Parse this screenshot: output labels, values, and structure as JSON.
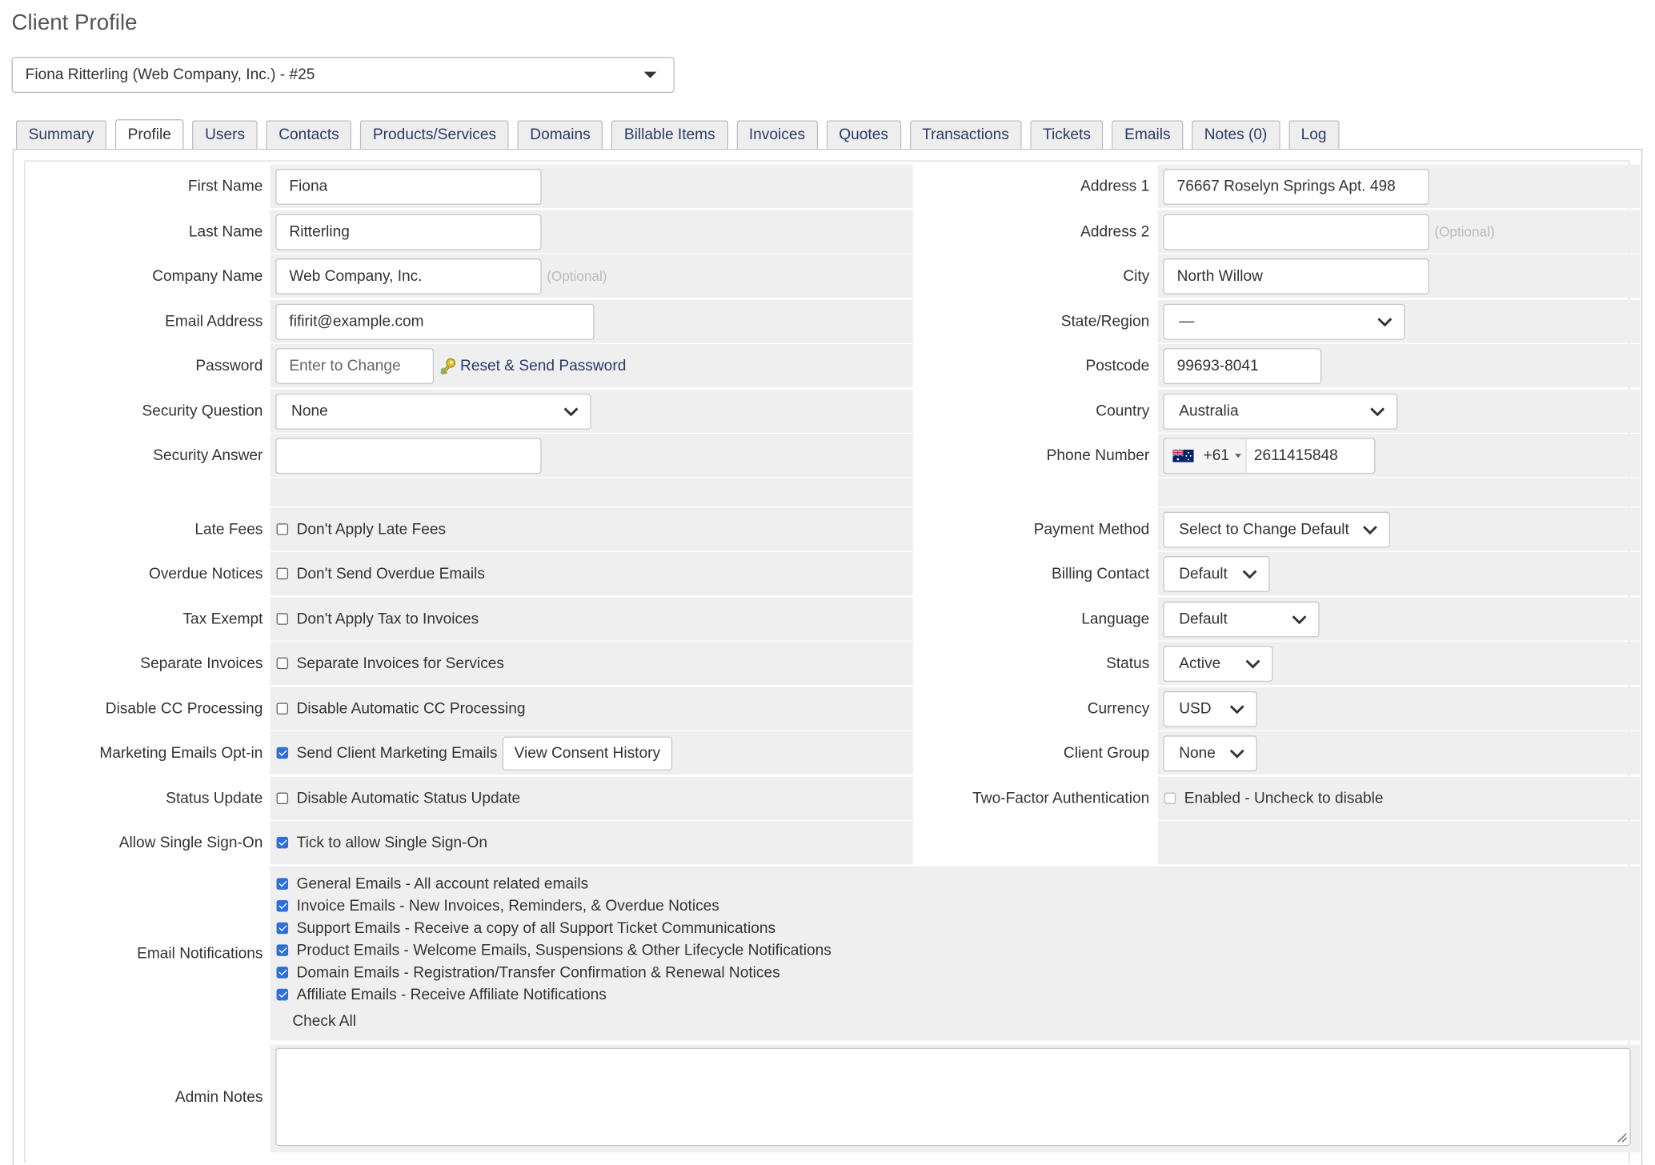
{
  "page": {
    "title": "Client Profile"
  },
  "client_selector": {
    "value": "Fiona Ritterling (Web Company, Inc.) - #25"
  },
  "tabs": [
    {
      "label": "Summary"
    },
    {
      "label": "Profile"
    },
    {
      "label": "Users"
    },
    {
      "label": "Contacts"
    },
    {
      "label": "Products/Services"
    },
    {
      "label": "Domains"
    },
    {
      "label": "Billable Items"
    },
    {
      "label": "Invoices"
    },
    {
      "label": "Quotes"
    },
    {
      "label": "Transactions"
    },
    {
      "label": "Tickets"
    },
    {
      "label": "Emails"
    },
    {
      "label": "Notes (0)"
    },
    {
      "label": "Log"
    }
  ],
  "active_tab": "Profile",
  "optional_text": "(Optional)",
  "left": {
    "first_name": {
      "label": "First Name",
      "value": "Fiona"
    },
    "last_name": {
      "label": "Last Name",
      "value": "Ritterling"
    },
    "company_name": {
      "label": "Company Name",
      "value": "Web Company, Inc."
    },
    "email": {
      "label": "Email Address",
      "value": "fifirit@example.com"
    },
    "password": {
      "label": "Password",
      "placeholder": "Enter to Change",
      "reset_link": "Reset & Send Password"
    },
    "security_question": {
      "label": "Security Question",
      "value": "None"
    },
    "security_answer": {
      "label": "Security Answer",
      "value": ""
    },
    "late_fees": {
      "label": "Late Fees",
      "text": "Don't Apply Late Fees",
      "checked": false
    },
    "overdue_notices": {
      "label": "Overdue Notices",
      "text": "Don't Send Overdue Emails",
      "checked": false
    },
    "tax_exempt": {
      "label": "Tax Exempt",
      "text": "Don't Apply Tax to Invoices",
      "checked": false
    },
    "separate_invoices": {
      "label": "Separate Invoices",
      "text": "Separate Invoices for Services",
      "checked": false
    },
    "disable_cc": {
      "label": "Disable CC Processing",
      "text": "Disable Automatic CC Processing",
      "checked": false
    },
    "marketing": {
      "label": "Marketing Emails Opt-in",
      "text": "Send Client Marketing Emails",
      "checked": true,
      "button": "View Consent History"
    },
    "status_update": {
      "label": "Status Update",
      "text": "Disable Automatic Status Update",
      "checked": false
    },
    "sso": {
      "label": "Allow Single Sign-On",
      "text": "Tick to allow Single Sign-On",
      "checked": true
    }
  },
  "right": {
    "address1": {
      "label": "Address 1",
      "value": "76667 Roselyn Springs Apt. 498"
    },
    "address2": {
      "label": "Address 2",
      "value": ""
    },
    "city": {
      "label": "City",
      "value": "North Willow"
    },
    "state": {
      "label": "State/Region",
      "value": "—"
    },
    "postcode": {
      "label": "Postcode",
      "value": "99693-8041"
    },
    "country": {
      "label": "Country",
      "value": "Australia"
    },
    "phone": {
      "label": "Phone Number",
      "dial_code": "+61",
      "value": "2611415848"
    },
    "payment_method": {
      "label": "Payment Method",
      "value": "Select to Change Default"
    },
    "billing_contact": {
      "label": "Billing Contact",
      "value": "Default"
    },
    "language": {
      "label": "Language",
      "value": "Default"
    },
    "status": {
      "label": "Status",
      "value": "Active"
    },
    "currency": {
      "label": "Currency",
      "value": "USD"
    },
    "client_group": {
      "label": "Client Group",
      "value": "None"
    },
    "two_factor": {
      "label": "Two-Factor Authentication",
      "text": "Enabled - Uncheck to disable",
      "checked": false
    }
  },
  "email_notifications": {
    "label": "Email Notifications",
    "items": [
      {
        "text": "General Emails - All account related emails",
        "checked": true
      },
      {
        "text": "Invoice Emails - New Invoices, Reminders, & Overdue Notices",
        "checked": true
      },
      {
        "text": "Support Emails - Receive a copy of all Support Ticket Communications",
        "checked": true
      },
      {
        "text": "Product Emails - Welcome Emails, Suspensions & Other Lifecycle Notifications",
        "checked": true
      },
      {
        "text": "Domain Emails - Registration/Transfer Confirmation & Renewal Notices",
        "checked": true
      },
      {
        "text": "Affiliate Emails - Receive Affiliate Notifications",
        "checked": true
      }
    ],
    "check_all": "Check All"
  },
  "admin_notes": {
    "label": "Admin Notes",
    "value": ""
  },
  "colors": {
    "link": "#2b3a67",
    "field_bg": "#efefef",
    "checkbox": "#2f6fd6"
  },
  "icons": {
    "key": "key-icon",
    "chevron": "chevron-down-icon",
    "flag": "australia-flag-icon",
    "resize": "resize-grip-icon"
  }
}
